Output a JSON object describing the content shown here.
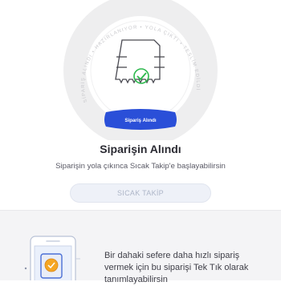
{
  "progress_ring": {
    "steps": [
      "SİPARİŞ ALINDI",
      "HAZIRLANIYOR",
      "YOLA ÇIKTI",
      "TESLİM EDİLDİ"
    ],
    "arc_labels": [
      "SİPARİŞ ALINDI",
      "HAZIRLANIYOR",
      "YOLA ÇIKTI",
      "TESLİM EDİLDİ"
    ],
    "badge_label": "Sipariş Alındı",
    "accent_color": "#2a4fd8",
    "ring_color": "#e6e6e8"
  },
  "status": {
    "title": "Siparişin Alındı",
    "subtitle": "Siparişin yola çıkınca Sıcak Takip'e başlayabilirsin"
  },
  "track_button": {
    "label": "SICAK TAKİP",
    "enabled": false
  },
  "promo": {
    "text": "Bir dahaki sefere daha hızlı sipariş vermek için bu siparişi Tek Tık olarak tanımlayabilirsin"
  },
  "icons": {
    "receipt": "receipt-check-icon",
    "phone": "phone-illustration-icon"
  }
}
